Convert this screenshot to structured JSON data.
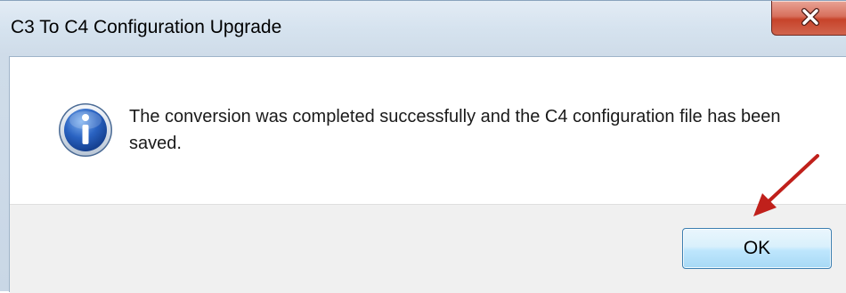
{
  "window": {
    "title": "C3 To C4 Configuration Upgrade",
    "close_icon": "close-x"
  },
  "dialog": {
    "icon": "info-icon",
    "message": "The conversion was completed successfully and the C4 configuration file has been saved.",
    "ok_label": "OK"
  },
  "annotation": {
    "arrow_color": "#c0201b",
    "icon": "red-arrow-icon"
  },
  "colors": {
    "info_icon_blue": "#1f5ab8",
    "close_red": "#c7432a",
    "ok_button_border": "#3c7fb1"
  }
}
